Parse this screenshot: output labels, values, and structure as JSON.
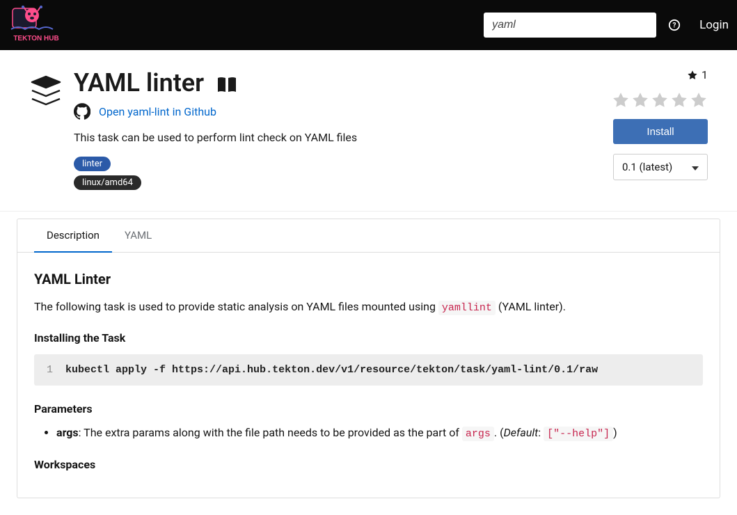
{
  "header": {
    "search_value": "yaml",
    "login_label": "Login"
  },
  "task": {
    "title": "YAML linter",
    "github_link_text": "Open yaml-lint in Github",
    "description": "This task can be used to perform lint check on YAML files",
    "tags": {
      "category": "linter",
      "platform": "linux/amd64"
    },
    "star_count": "1",
    "install_label": "Install",
    "version_selected": "0.1 (latest)"
  },
  "tabs": {
    "description": "Description",
    "yaml": "YAML"
  },
  "content": {
    "title": "YAML Linter",
    "intro_prefix": "The following task is used to provide static analysis on YAML files mounted using ",
    "intro_code": "yamllint",
    "intro_suffix": " (YAML linter).",
    "install_heading": "Installing the Task",
    "install_cmd": "kubectl apply -f https://api.hub.tekton.dev/v1/resource/tekton/task/yaml-lint/0.1/raw",
    "params_heading": "Parameters",
    "param": {
      "name": "args",
      "desc": ": The extra params along with the file path needs to be provided as the part of ",
      "ref": "args",
      "default_label": "Default",
      "default_value": "[\"--help\"]"
    },
    "workspaces_heading": "Workspaces"
  }
}
